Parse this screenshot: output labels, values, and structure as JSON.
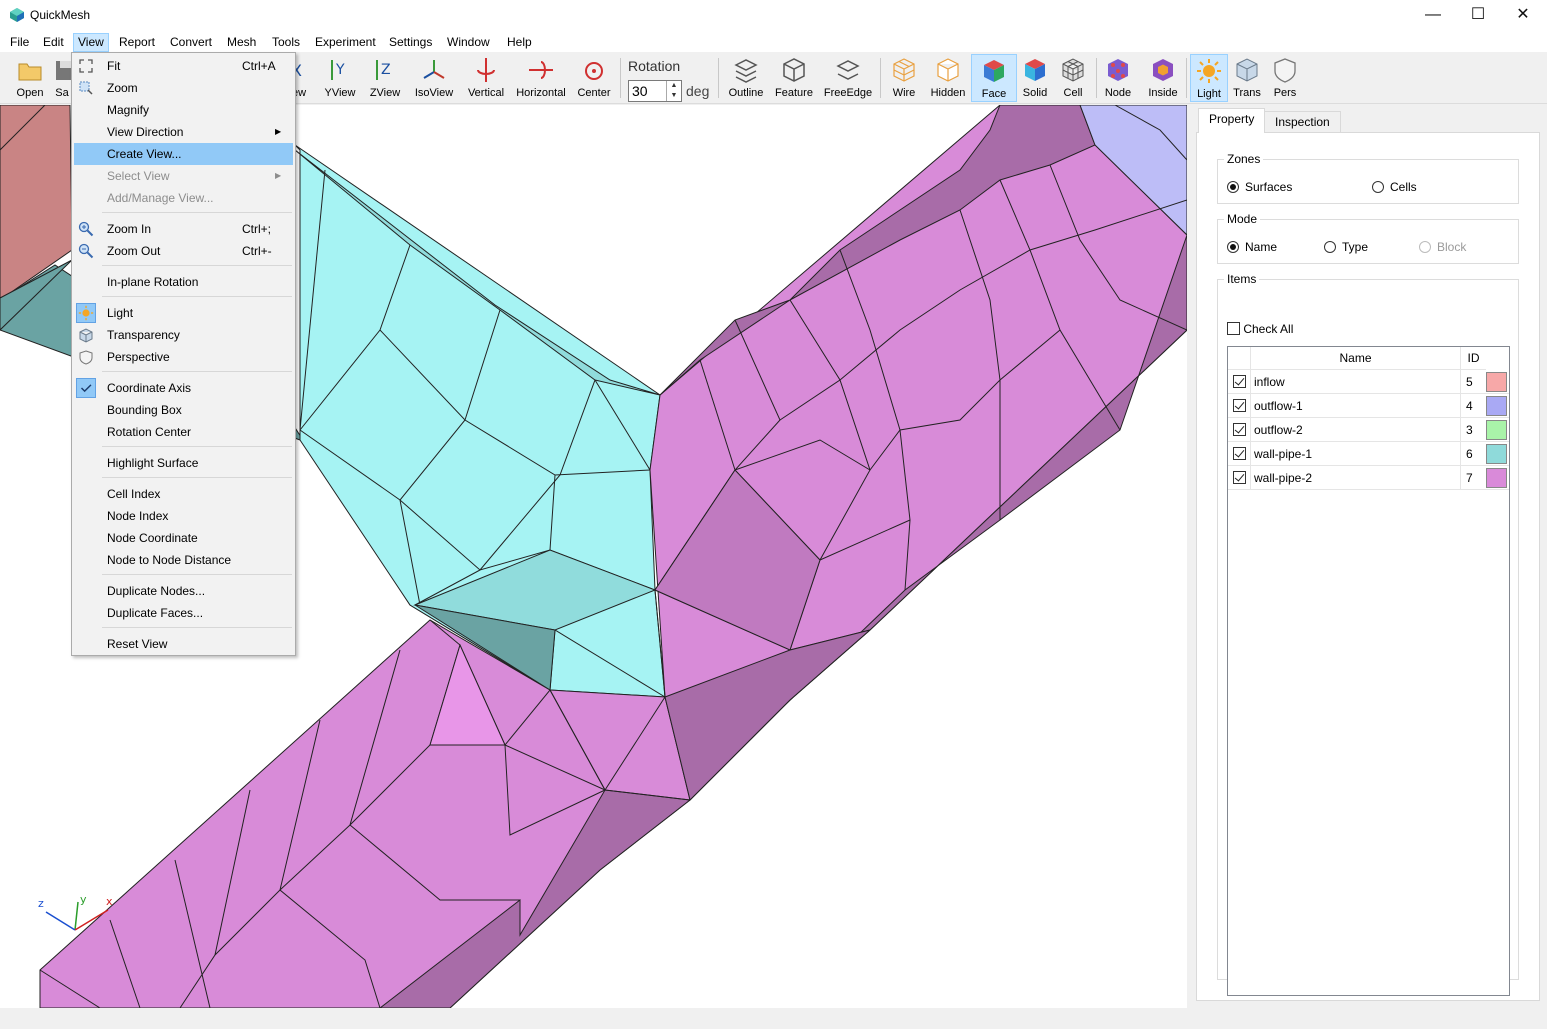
{
  "app": {
    "title": "QuickMesh",
    "logo_icon": "app-logo-icon"
  },
  "window_controls": {
    "minimize": "—",
    "maximize": "☐",
    "close": "✕"
  },
  "menubar": [
    "File",
    "Edit",
    "View",
    "Report",
    "Convert",
    "Mesh",
    "Tools",
    "Experiment",
    "Settings",
    "Window",
    "Help"
  ],
  "toolbar": {
    "buttons": [
      {
        "label": "Open",
        "icon": "folder-icon"
      },
      {
        "label": "Sa",
        "icon": "save-icon"
      },
      {
        "label": "ew",
        "icon": "xview-icon"
      },
      {
        "label": "YView",
        "icon": "yview-icon"
      },
      {
        "label": "ZView",
        "icon": "zview-icon"
      },
      {
        "label": "IsoView",
        "icon": "isoview-icon"
      },
      {
        "label": "Vertical",
        "icon": "vertical-icon"
      },
      {
        "label": "Horizontal",
        "icon": "horizontal-icon"
      },
      {
        "label": "Center",
        "icon": "center-icon"
      },
      {
        "label": "Outline",
        "icon": "outline-icon"
      },
      {
        "label": "Feature",
        "icon": "feature-icon"
      },
      {
        "label": "FreeEdge",
        "icon": "freeedge-icon"
      },
      {
        "label": "Wire",
        "icon": "wire-icon"
      },
      {
        "label": "Hidden",
        "icon": "hidden-icon"
      },
      {
        "label": "Face",
        "icon": "face-icon",
        "pressed": true
      },
      {
        "label": "Solid",
        "icon": "solid-icon"
      },
      {
        "label": "Cell",
        "icon": "cell-icon"
      },
      {
        "label": "Node",
        "icon": "node-icon"
      },
      {
        "label": "Inside",
        "icon": "inside-icon"
      },
      {
        "label": "Light",
        "icon": "light-icon",
        "pressed": true
      },
      {
        "label": "Trans",
        "icon": "trans-icon"
      },
      {
        "label": "Pers",
        "icon": "pers-icon"
      }
    ],
    "rotation": {
      "label": "Rotation",
      "value": "30",
      "unit": "deg"
    }
  },
  "view_menu": {
    "items": [
      {
        "label": "Fit",
        "shortcut": "Ctrl+A",
        "icon": "fit-icon"
      },
      {
        "label": "Zoom",
        "icon": "zoom-icon"
      },
      {
        "label": "Magnify"
      },
      {
        "label": "View Direction",
        "submenu": true
      },
      {
        "label": "Create View...",
        "highlighted": true
      },
      {
        "label": "Select View",
        "submenu": true,
        "disabled": true
      },
      {
        "label": "Add/Manage View...",
        "disabled": true
      },
      {
        "label": "Zoom In",
        "shortcut": "Ctrl+;",
        "icon": "zoom-in-icon"
      },
      {
        "label": "Zoom Out",
        "shortcut": "Ctrl+-",
        "icon": "zoom-out-icon"
      },
      {
        "label": "In-plane Rotation"
      },
      {
        "label": "Light",
        "icon": "light-icon",
        "checked": true
      },
      {
        "label": "Transparency",
        "icon": "transparency-icon"
      },
      {
        "label": "Perspective",
        "icon": "perspective-icon"
      },
      {
        "label": "Coordinate Axis",
        "icon": "checkmark-icon",
        "checked": true
      },
      {
        "label": "Bounding Box"
      },
      {
        "label": "Rotation Center"
      },
      {
        "label": "Highlight Surface"
      },
      {
        "label": "Cell Index"
      },
      {
        "label": "Node Index"
      },
      {
        "label": "Node Coordinate"
      },
      {
        "label": "Node to Node Distance"
      },
      {
        "label": "Duplicate Nodes..."
      },
      {
        "label": "Duplicate Faces..."
      },
      {
        "label": "Reset View"
      }
    ]
  },
  "panel": {
    "tabs": [
      "Property",
      "Inspection"
    ],
    "zones": {
      "title": "Zones",
      "options": [
        "Surfaces",
        "Cells"
      ],
      "selected": "Surfaces"
    },
    "mode": {
      "title": "Mode",
      "options": [
        "Name",
        "Type",
        "Block"
      ],
      "selected": "Name",
      "disabled": [
        "Block"
      ]
    },
    "items": {
      "title": "Items",
      "check_all": "Check All",
      "columns": [
        "Name",
        "ID"
      ],
      "rows": [
        {
          "name": "inflow",
          "id": "5",
          "color": "#f7a8a8",
          "checked": true
        },
        {
          "name": "outflow-1",
          "id": "4",
          "color": "#a9a9f4",
          "checked": true
        },
        {
          "name": "outflow-2",
          "id": "3",
          "color": "#a9f4a9",
          "checked": true
        },
        {
          "name": "wall-pipe-1",
          "id": "6",
          "color": "#8fdada",
          "checked": true
        },
        {
          "name": "wall-pipe-2",
          "id": "7",
          "color": "#d98ad9",
          "checked": true
        }
      ]
    }
  },
  "axis": {
    "x": "x",
    "y": "y",
    "z": "z"
  },
  "colors": {
    "pipe1_light": "#a8f4f4",
    "pipe1_mid": "#90dede",
    "pipe1_dark": "#66a3a3",
    "pipe2_light": "#d88bd8",
    "pipe2_mid": "#c07ac0",
    "pipe2_dark": "#a86ca8",
    "inflow": "#c98484",
    "outflow1": "#bdbdf7"
  }
}
